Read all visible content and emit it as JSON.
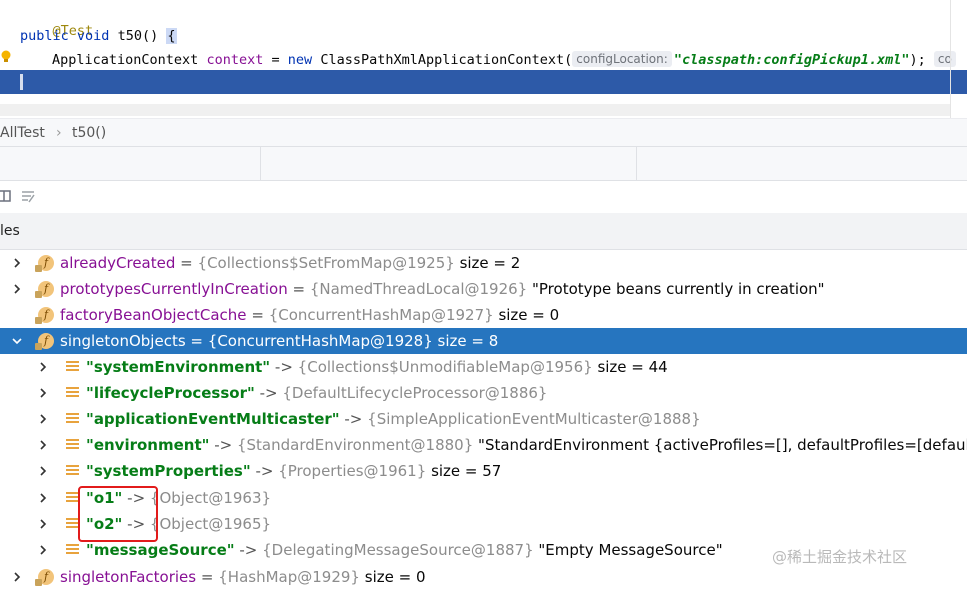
{
  "editor": {
    "line1": {
      "annotation": "@Test"
    },
    "line2": {
      "kw1": "public",
      "kw2": "void",
      "method": "t50()",
      "brace": "{"
    },
    "line3": {
      "type": "ApplicationContext",
      "var": "context",
      "eq": "=",
      "kw_new": "new",
      "ctor": "ClassPathXmlApplicationContext(",
      "hint": "configLocation:",
      "arg": "\"classpath:configPickup1.xml\"",
      "end": ");",
      "trailing_hint": "co"
    }
  },
  "breadcrumb": {
    "class": "AllTest",
    "sep": "›",
    "method": "t50()"
  },
  "variables_header": "les",
  "tree": [
    {
      "name": "alreadyCreated",
      "eq": "=",
      "type": "{Collections$SetFromMap@1925}",
      "value": "size = 2",
      "expand": "right"
    },
    {
      "name": "prototypesCurrentlyInCreation",
      "eq": "=",
      "type": "{NamedThreadLocal@1926}",
      "value": "\"Prototype beans currently in creation\"",
      "expand": "right"
    },
    {
      "name": "factoryBeanObjectCache",
      "eq": "=",
      "type": "{ConcurrentHashMap@1927}",
      "value": "size = 0",
      "expand": "none"
    },
    {
      "name": "singletonObjects",
      "eq": "=",
      "type": "{ConcurrentHashMap@1928}",
      "value": "size = 8",
      "expand": "down",
      "selected": true
    },
    {
      "key": "\"systemEnvironment\"",
      "arrow": "->",
      "type": "{Collections$UnmodifiableMap@1956}",
      "value": "size = 44"
    },
    {
      "key": "\"lifecycleProcessor\"",
      "arrow": "->",
      "type": "{DefaultLifecycleProcessor@1886}",
      "value": ""
    },
    {
      "key": "\"applicationEventMulticaster\"",
      "arrow": "->",
      "type": "{SimpleApplicationEventMulticaster@1888}",
      "value": ""
    },
    {
      "key": "\"environment\"",
      "arrow": "->",
      "type": "{StandardEnvironment@1880}",
      "value": "\"StandardEnvironment {activeProfiles=[], defaultProfiles=[default], prop"
    },
    {
      "key": "\"systemProperties\"",
      "arrow": "->",
      "type": "{Properties@1961}",
      "value": "size = 57"
    },
    {
      "key": "\"o1\"",
      "arrow": "->",
      "type": "{Object@1963}",
      "value": ""
    },
    {
      "key": "\"o2\"",
      "arrow": "->",
      "type": "{Object@1965}",
      "value": ""
    },
    {
      "key": "\"messageSource\"",
      "arrow": "->",
      "type": "{DelegatingMessageSource@1887}",
      "value": "\"Empty MessageSource\""
    },
    {
      "name": "singletonFactories",
      "eq": "=",
      "type": "{HashMap@1929}",
      "value": "size = 0",
      "expand": "right",
      "partial": true
    }
  ],
  "watermark": "@稀土掘金技术社区",
  "colors": {
    "selection": "#2675bf",
    "current_line": "#2d5aa8",
    "highlight_box": "#e21b1b"
  }
}
